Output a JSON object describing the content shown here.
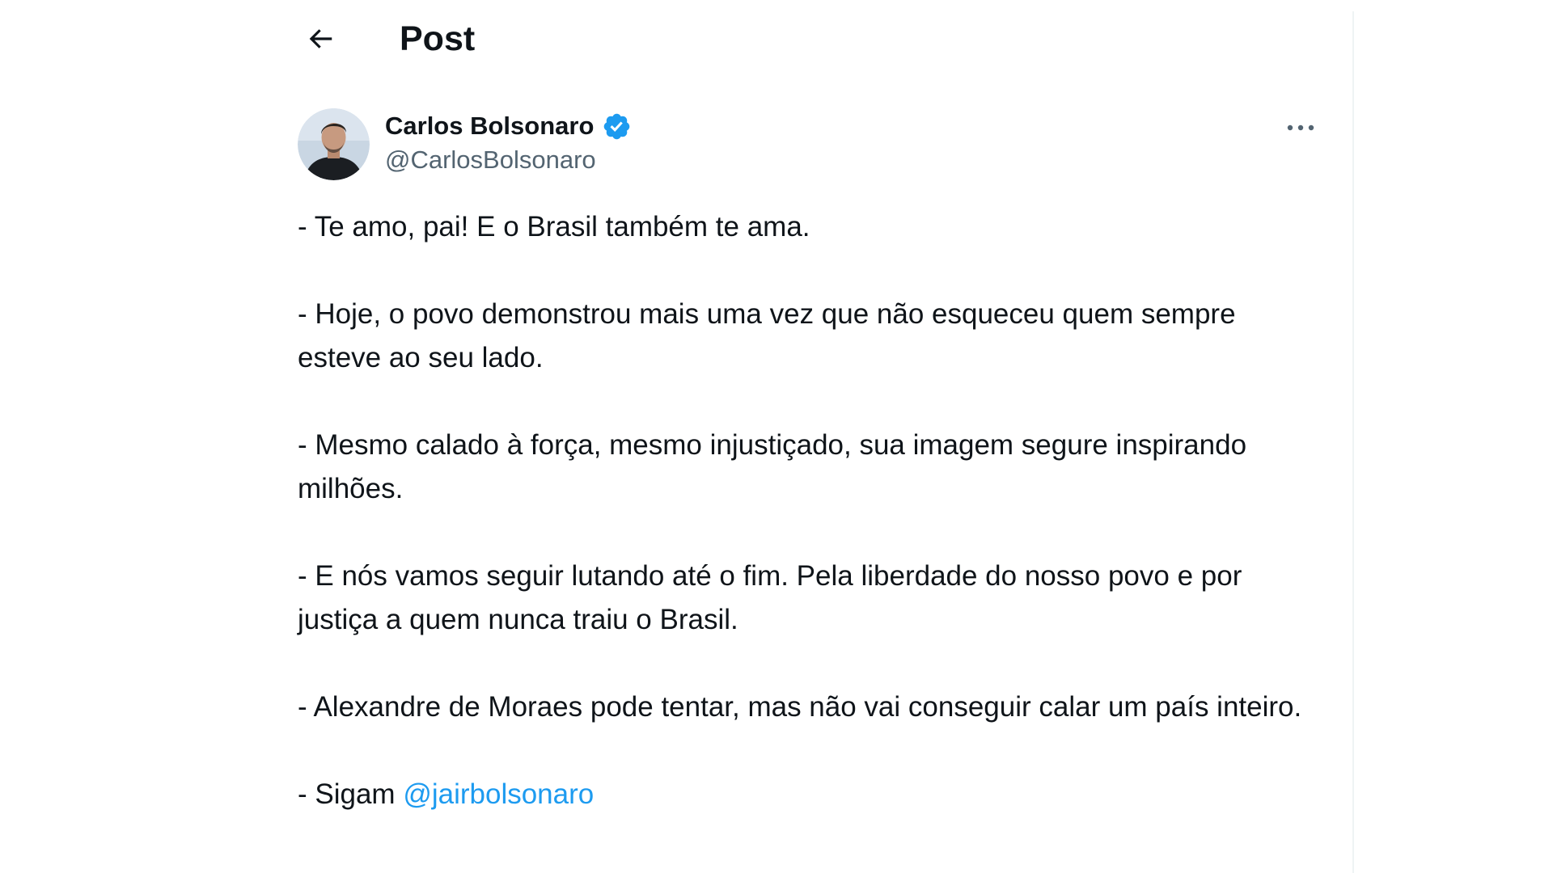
{
  "header": {
    "title": "Post",
    "back_icon": "arrow-left-icon"
  },
  "author": {
    "display_name": "Carlos Bolsonaro",
    "handle": "@CarlosBolsonaro",
    "verified_icon": "verified-badge-icon",
    "more_icon": "more-horizontal-icon"
  },
  "tweet": {
    "paragraphs": [
      "- Te amo, pai! E o Brasil também te ama.",
      "- Hoje, o povo demonstrou mais uma vez que não esqueceu quem sempre esteve ao seu lado.",
      "- Mesmo calado à força, mesmo injustiçado, sua imagem segure inspirando milhões.",
      "- E nós vamos seguir lutando até o fim. Pela liberdade do nosso povo e por justiça a quem nunca traiu o Brasil.",
      "- Alexandre de Moraes pode tentar, mas não vai conseguir calar um país inteiro."
    ],
    "last_prefix": "- Sigam ",
    "mention": "@jairbolsonaro"
  },
  "colors": {
    "accent": "#1d9bf0",
    "text": "#0f1419",
    "secondary": "#536471",
    "border": "#eff3f4"
  }
}
